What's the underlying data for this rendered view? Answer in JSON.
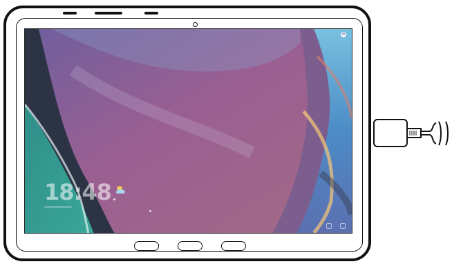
{
  "device": {
    "type": "rugged tablet"
  },
  "lockscreen": {
    "clock": "18:48"
  },
  "colors": {
    "frame": "#111111",
    "wallpaper_purple": "#8a5b86",
    "wallpaper_teal": "#4fb7a4",
    "wallpaper_blue": "#5aa6d6"
  },
  "icons": {
    "status": "settings-icon",
    "weather": "partly-cloudy-icon",
    "connector": "usb-c-connector-icon"
  }
}
